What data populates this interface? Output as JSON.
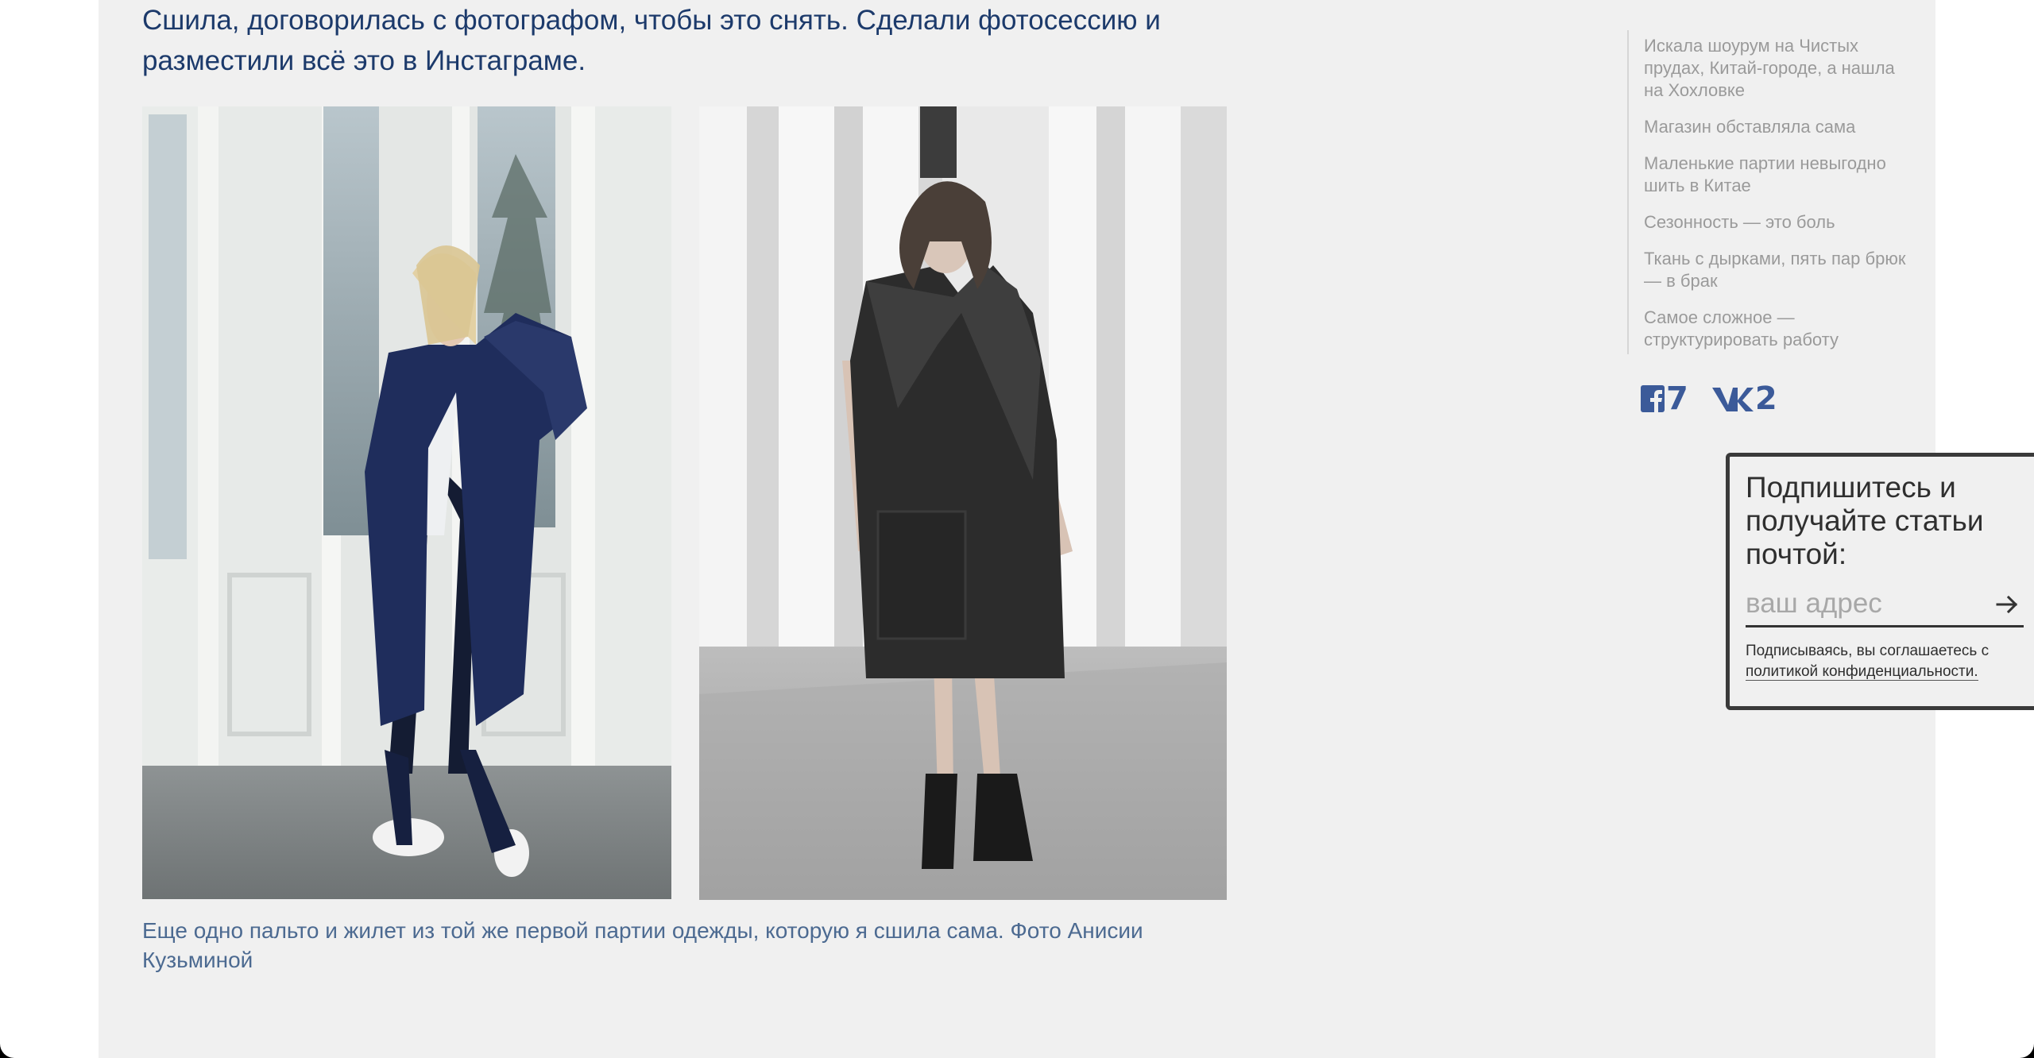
{
  "article": {
    "paragraph": "Сшила, договорилась с фотографом, чтобы это снять. Сделали фотосессию и разместили всё это в Инстаграме.",
    "caption": "Еще одно пальто и жилет из той же первой партии одежды, которую я сшила сама. Фото Анисии Кузьминой"
  },
  "toc": {
    "items": [
      {
        "label": "Искала шоурум на Чистых прудах, Китай-городе, а нашла на Хохловке"
      },
      {
        "label": "Магазин обставляла сама"
      },
      {
        "label": "Маленькие партии невыгодно шить в Китае"
      },
      {
        "label": "Сезонность — это боль"
      },
      {
        "label": "Ткань с дырками, пять пар брюк — в брак"
      },
      {
        "label": "Самое сложное — структурировать работу"
      }
    ]
  },
  "share": {
    "facebook": {
      "icon": "facebook-icon",
      "count": "7"
    },
    "vk": {
      "icon": "vk-icon",
      "count": "2"
    },
    "color": "#3b5a99"
  },
  "subscribe": {
    "title": "Подпишитесь и получайте статьи почтой:",
    "placeholder": "ваш адрес",
    "submit_icon": "arrow-right-icon",
    "note_prefix": "Подписываясь, вы соглашаетесь с",
    "policy_link": "политикой конфиденциальности."
  },
  "colors": {
    "page_background": "#f0f0f0",
    "heading_text": "#1c3a6b",
    "caption_text": "#4c6a91",
    "toc_text": "#9a9a9a",
    "box_border": "#3a3a3a"
  }
}
